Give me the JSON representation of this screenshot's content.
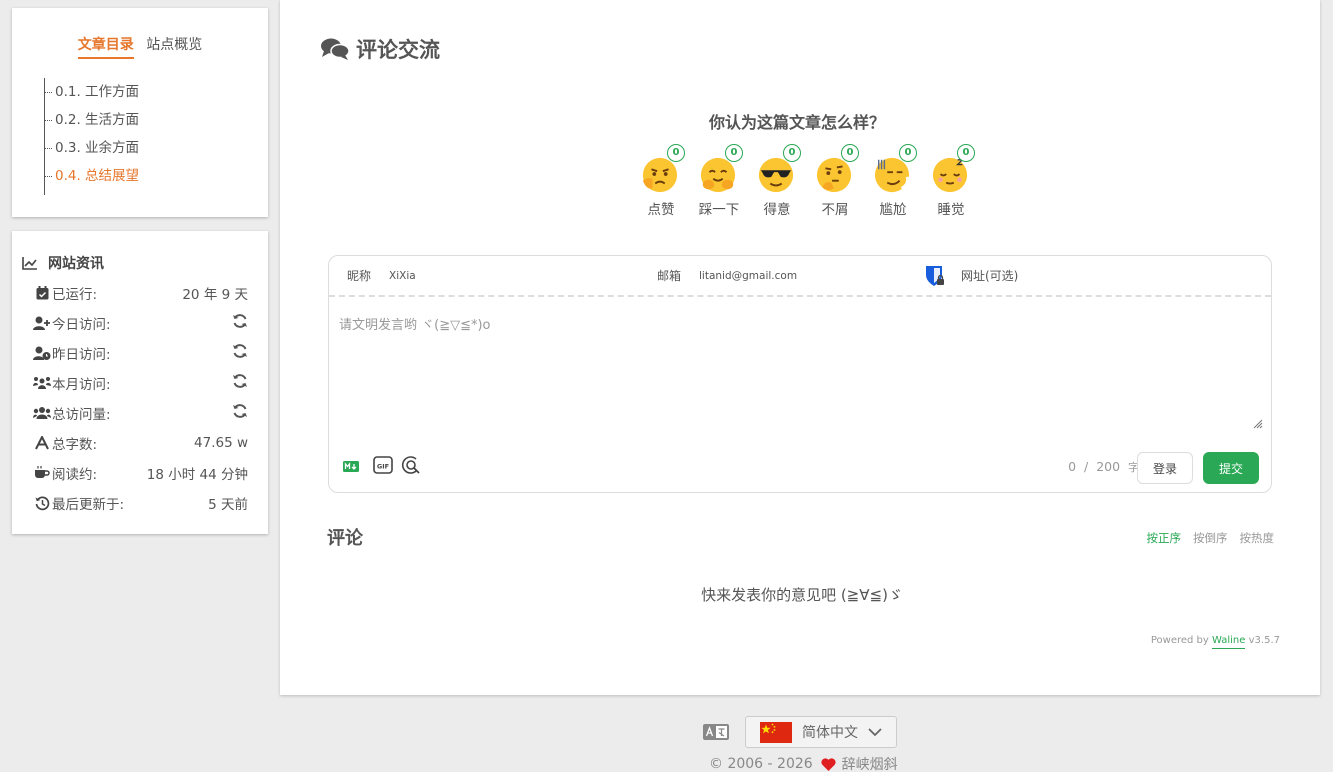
{
  "toc": {
    "tabs": [
      {
        "label": "文章目录",
        "active": true
      },
      {
        "label": "站点概览",
        "active": false
      }
    ],
    "items": [
      {
        "label": "0.1. 工作方面",
        "active": false
      },
      {
        "label": "0.2. 生活方面",
        "active": false
      },
      {
        "label": "0.3. 业余方面",
        "active": false
      },
      {
        "label": "0.4. 总结展望",
        "active": true
      }
    ]
  },
  "site_info": {
    "title": "网站资讯",
    "rows": [
      {
        "icon": "calendar-check-icon",
        "label": "已运行:",
        "value": "20 年 9 天"
      },
      {
        "icon": "user-plus-icon",
        "label": "今日访问:",
        "value": "",
        "loading": true
      },
      {
        "icon": "user-clock-icon",
        "label": "昨日访问:",
        "value": "",
        "loading": true
      },
      {
        "icon": "users-group-icon",
        "label": "本月访问:",
        "value": "",
        "loading": true
      },
      {
        "icon": "users-icon",
        "label": "总访问量:",
        "value": "",
        "loading": true
      },
      {
        "icon": "font-icon",
        "label": "总字数:",
        "value": "47.65 w"
      },
      {
        "icon": "coffee-icon",
        "label": "阅读约:",
        "value": "18 小时 44 分钟"
      },
      {
        "icon": "history-icon",
        "label": "最后更新于:",
        "value": "5 天前"
      }
    ]
  },
  "main": {
    "title": "评论交流",
    "question": "你认为这篇文章怎么样？",
    "reactions": [
      {
        "label": "点赞",
        "count": "0"
      },
      {
        "label": "踩一下",
        "count": "0"
      },
      {
        "label": "得意",
        "count": "0"
      },
      {
        "label": "不屑",
        "count": "0"
      },
      {
        "label": "尴尬",
        "count": "0"
      },
      {
        "label": "睡觉",
        "count": "0"
      }
    ],
    "editor": {
      "nick_label": "昵称",
      "nick_value": "XiXia",
      "mail_label": "邮箱",
      "mail_value": "litanid@gmail.com",
      "link_label": "网址(可选)",
      "placeholder": "请文明发言哟 ヾ(≧▽≦*)o",
      "word_count": "0",
      "word_limit": "200",
      "word_unit": "字",
      "login_label": "登录",
      "submit_label": "提交"
    },
    "comments_title": "评论",
    "sort": [
      {
        "label": "按正序",
        "active": true
      },
      {
        "label": "按倒序",
        "active": false
      },
      {
        "label": "按热度",
        "active": false
      }
    ],
    "empty_text": "快来发表你的意见吧 (≧∀≦)ゞ",
    "powered_prefix": "Powered by",
    "powered_link": "Waline",
    "powered_version": "v3.5.7"
  },
  "footer": {
    "language": "简体中文",
    "copyright": "© 2006 - 2026",
    "author": "辞峡烟斜"
  },
  "colors": {
    "accent_orange": "#e6772d",
    "accent_green": "#2aa855"
  }
}
